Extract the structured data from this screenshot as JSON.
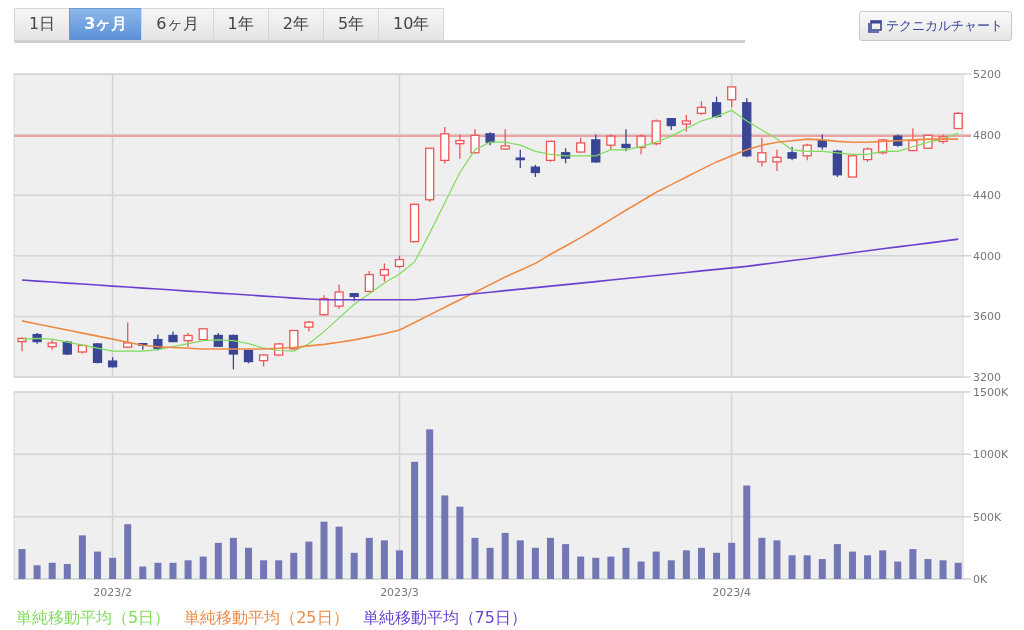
{
  "tabs": [
    {
      "label": "1日",
      "selected": false
    },
    {
      "label": "3ヶ月",
      "selected": true
    },
    {
      "label": "6ヶ月",
      "selected": false
    },
    {
      "label": "1年",
      "selected": false
    },
    {
      "label": "2年",
      "selected": false
    },
    {
      "label": "5年",
      "selected": false
    },
    {
      "label": "10年",
      "selected": false
    }
  ],
  "technical_chart_button": {
    "label": "テクニカルチャート"
  },
  "price_chart": {
    "chart_data": {
      "type": "candlestick",
      "grid": true,
      "categories": [
        null,
        null,
        null,
        null,
        null,
        null,
        null,
        null,
        null,
        null,
        null,
        null,
        null,
        null,
        null,
        null,
        null,
        null,
        null,
        null,
        null,
        null,
        null,
        null,
        null,
        null,
        null,
        null,
        null,
        null,
        null,
        null,
        null,
        null,
        null,
        null,
        null,
        null,
        null,
        null,
        null,
        null,
        null,
        null,
        null,
        null,
        null,
        null,
        null,
        null,
        null,
        null,
        null,
        null,
        null,
        null,
        null,
        null,
        null,
        null,
        null,
        null,
        null
      ],
      "ylim": [
        3200,
        5200
      ],
      "yticks": [
        3200,
        3600,
        4000,
        4400,
        4800,
        5200
      ],
      "ref_lines": [
        {
          "axis": "y",
          "value": 4790,
          "color": "#f0a0a0"
        }
      ],
      "ohlc": [
        [
          3434,
          3460,
          3370,
          3455
        ],
        [
          3480,
          3490,
          3420,
          3434
        ],
        [
          3400,
          3445,
          3380,
          3425
        ],
        [
          3430,
          3440,
          3345,
          3352
        ],
        [
          3365,
          3415,
          3355,
          3408
        ],
        [
          3418,
          3425,
          3290,
          3297
        ],
        [
          3305,
          3330,
          3262,
          3268
        ],
        [
          3397,
          3560,
          3390,
          3425
        ],
        [
          3420,
          3425,
          3380,
          3410
        ],
        [
          3447,
          3480,
          3375,
          3390
        ],
        [
          3474,
          3500,
          3430,
          3434
        ],
        [
          3440,
          3490,
          3400,
          3474
        ],
        [
          3447,
          3520,
          3440,
          3518
        ],
        [
          3474,
          3490,
          3400,
          3403
        ],
        [
          3474,
          3480,
          3250,
          3352
        ],
        [
          3375,
          3380,
          3290,
          3302
        ],
        [
          3308,
          3350,
          3270,
          3345
        ],
        [
          3345,
          3425,
          3340,
          3418
        ],
        [
          3386,
          3510,
          3380,
          3507
        ],
        [
          3529,
          3570,
          3500,
          3562
        ],
        [
          3611,
          3740,
          3605,
          3717
        ],
        [
          3668,
          3810,
          3650,
          3761
        ],
        [
          3750,
          3755,
          3700,
          3732
        ],
        [
          3765,
          3900,
          3760,
          3876
        ],
        [
          3872,
          3950,
          3830,
          3909
        ],
        [
          3930,
          4000,
          3920,
          3975
        ],
        [
          4093,
          4340,
          4090,
          4340
        ],
        [
          4370,
          4710,
          4355,
          4710
        ],
        [
          4630,
          4850,
          4610,
          4805
        ],
        [
          4740,
          4800,
          4640,
          4760
        ],
        [
          4680,
          4835,
          4675,
          4795
        ],
        [
          4805,
          4815,
          4730,
          4750
        ],
        [
          4705,
          4835,
          4700,
          4725
        ],
        [
          4645,
          4700,
          4580,
          4635
        ],
        [
          4585,
          4600,
          4520,
          4550
        ],
        [
          4630,
          4760,
          4620,
          4755
        ],
        [
          4680,
          4710,
          4610,
          4645
        ],
        [
          4685,
          4780,
          4680,
          4745
        ],
        [
          4765,
          4800,
          4615,
          4620
        ],
        [
          4730,
          4800,
          4700,
          4790
        ],
        [
          4735,
          4835,
          4690,
          4715
        ],
        [
          4715,
          4800,
          4670,
          4790
        ],
        [
          4740,
          4900,
          4730,
          4890
        ],
        [
          4905,
          4910,
          4830,
          4860
        ],
        [
          4870,
          4930,
          4820,
          4890
        ],
        [
          4940,
          5020,
          4930,
          4980
        ],
        [
          5010,
          5050,
          4910,
          4920
        ],
        [
          5030,
          5115,
          4980,
          5115
        ],
        [
          5010,
          5040,
          4650,
          4660
        ],
        [
          4620,
          4780,
          4590,
          4680
        ],
        [
          4620,
          4700,
          4560,
          4650
        ],
        [
          4680,
          4720,
          4630,
          4645
        ],
        [
          4660,
          4740,
          4630,
          4730
        ],
        [
          4760,
          4800,
          4700,
          4720
        ],
        [
          4690,
          4700,
          4520,
          4535
        ],
        [
          4520,
          4660,
          4520,
          4660
        ],
        [
          4635,
          4715,
          4620,
          4705
        ],
        [
          4680,
          4770,
          4670,
          4765
        ],
        [
          4790,
          4800,
          4720,
          4730
        ],
        [
          4695,
          4840,
          4690,
          4760
        ],
        [
          4710,
          4800,
          4705,
          4795
        ],
        [
          4755,
          4800,
          4740,
          4785
        ],
        [
          4840,
          4950,
          4840,
          4940
        ]
      ],
      "series": [
        {
          "name": "単純移動平均（5日）",
          "type": "line",
          "color": "#7fdc5a",
          "values": [
            3450,
            3455,
            3450,
            3430,
            3410,
            3390,
            3370,
            3370,
            3370,
            3380,
            3400,
            3420,
            3440,
            3445,
            3440,
            3420,
            3390,
            3375,
            3370,
            3420,
            3500,
            3590,
            3680,
            3750,
            3820,
            3880,
            3960,
            4150,
            4350,
            4550,
            4700,
            4750,
            4750,
            4730,
            4690,
            4670,
            4660,
            4660,
            4660,
            4700,
            4700,
            4720,
            4750,
            4790,
            4840,
            4890,
            4920,
            4960,
            4890,
            4830,
            4770,
            4700,
            4690,
            4690,
            4680,
            4670,
            4670,
            4690,
            4690,
            4720,
            4750,
            4770,
            4810
          ]
        },
        {
          "name": "単純移動平均（25日）",
          "type": "line",
          "color": "#ee8a45",
          "values": [
            3570,
            3550,
            3530,
            3510,
            3490,
            3470,
            3450,
            3430,
            3410,
            3400,
            3395,
            3390,
            3385,
            3385,
            3385,
            3385,
            3385,
            3390,
            3395,
            3405,
            3415,
            3430,
            3445,
            3465,
            3485,
            3510,
            3560,
            3610,
            3660,
            3710,
            3760,
            3810,
            3860,
            3905,
            3950,
            4010,
            4065,
            4120,
            4180,
            4240,
            4300,
            4360,
            4420,
            4470,
            4520,
            4570,
            4620,
            4660,
            4700,
            4730,
            4750,
            4760,
            4770,
            4765,
            4755,
            4750,
            4750,
            4755,
            4760,
            4765,
            4770,
            4770,
            4770
          ]
        },
        {
          "name": "単純移動平均（75日）",
          "type": "line",
          "color": "#6a40d0",
          "values": [
            3840,
            3833,
            3827,
            3820,
            3814,
            3807,
            3800,
            3794,
            3787,
            3781,
            3774,
            3767,
            3761,
            3754,
            3748,
            3741,
            3734,
            3728,
            3721,
            3715,
            3710,
            3710,
            3710,
            3710,
            3710,
            3710,
            3710,
            3720,
            3730,
            3740,
            3750,
            3760,
            3770,
            3780,
            3790,
            3800,
            3810,
            3820,
            3830,
            3840,
            3850,
            3860,
            3870,
            3880,
            3890,
            3900,
            3910,
            3920,
            3930,
            3943,
            3956,
            3969,
            3981,
            3994,
            4007,
            4020,
            4033,
            4046,
            4059,
            4071,
            4084,
            4097,
            4110
          ]
        }
      ]
    }
  },
  "volume_chart": {
    "chart_data": {
      "type": "bar",
      "grid": true,
      "categories": [
        null,
        null,
        null,
        null,
        null,
        null,
        "2023/2",
        null,
        null,
        null,
        null,
        null,
        null,
        null,
        null,
        null,
        null,
        null,
        null,
        null,
        null,
        null,
        null,
        null,
        null,
        "2023/3",
        null,
        null,
        null,
        null,
        null,
        null,
        null,
        null,
        null,
        null,
        null,
        null,
        null,
        null,
        null,
        null,
        null,
        null,
        null,
        null,
        null,
        "2023/4",
        null,
        null,
        null,
        null,
        null,
        null,
        null,
        null,
        null,
        null,
        null,
        null,
        null,
        null,
        null
      ],
      "ylim": [
        0,
        1500000
      ],
      "yticks": [
        {
          "value": 0,
          "label": "0K"
        },
        {
          "value": 500000,
          "label": "500K"
        },
        {
          "value": 1000000,
          "label": "1000K"
        },
        {
          "value": 1500000,
          "label": "1500K"
        }
      ],
      "series": [
        {
          "color": "#7276b4",
          "values": [
            240000,
            110000,
            130000,
            120000,
            350000,
            220000,
            170000,
            440000,
            100000,
            130000,
            130000,
            150000,
            180000,
            290000,
            330000,
            250000,
            150000,
            150000,
            210000,
            300000,
            460000,
            420000,
            210000,
            330000,
            310000,
            230000,
            940000,
            1200000,
            670000,
            580000,
            330000,
            250000,
            370000,
            310000,
            250000,
            330000,
            280000,
            180000,
            170000,
            180000,
            250000,
            140000,
            220000,
            150000,
            230000,
            250000,
            210000,
            290000,
            750000,
            330000,
            310000,
            190000,
            190000,
            160000,
            280000,
            220000,
            190000,
            230000,
            140000,
            240000,
            160000,
            150000,
            130000
          ]
        }
      ]
    }
  }
}
